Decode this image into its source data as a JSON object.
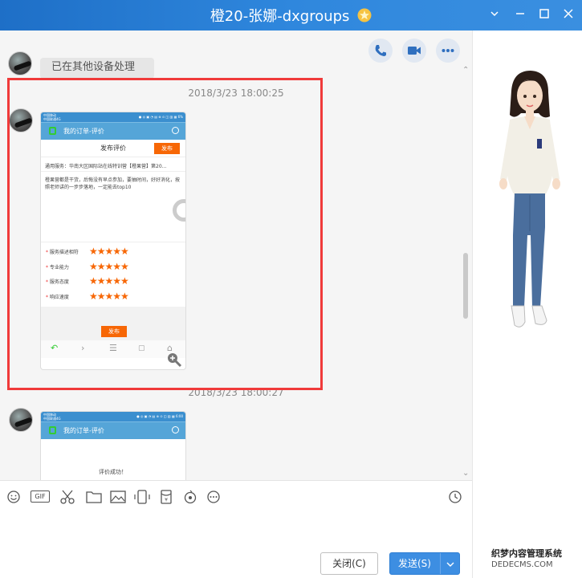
{
  "window": {
    "title": "橙20-张娜-dxgroups"
  },
  "chat": {
    "prev_message": "已在其他设备处理",
    "messages": [
      {
        "timestamp": "2018/3/23 18:00:25"
      },
      {
        "timestamp": "2018/3/23 18:00:27"
      }
    ]
  },
  "phone1": {
    "nav_title": "我的订单-评价",
    "header_title": "发布评价",
    "publish_top": "发布",
    "service": "通用服务：华南大区国际站在线特训营【橙果营】第20...",
    "review_text": "橙果营都是干货，后悔没有早点参加，要抽时间，好好消化，按照老师讲的一步步落地，一定能去top10",
    "ratings": [
      {
        "label": "服务描述相符",
        "stars": 5
      },
      {
        "label": "专业能力",
        "stars": 5
      },
      {
        "label": "服务态度",
        "stars": 5
      },
      {
        "label": "响应速度",
        "stars": 5
      }
    ],
    "publish_bottom": "发布",
    "star_text": "★★★★★"
  },
  "phone2": {
    "nav_title": "我的订单-评价",
    "success_text": "评价成功！"
  },
  "toolbar": {
    "gif_label": "GIF",
    "close_button": "关闭(C)",
    "send_button": "发送(S)"
  },
  "watermark": {
    "line1": "织梦内容管理系统",
    "line2": "DEDECMS.COM"
  },
  "colors": {
    "title_bar": "#2f87dd",
    "highlight_box": "#f03a3a",
    "send_button": "#3d8ee2",
    "accent_orange": "#f76706"
  }
}
